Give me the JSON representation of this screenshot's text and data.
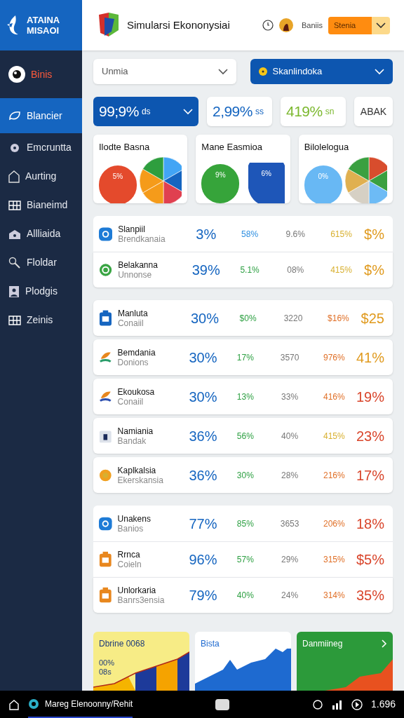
{
  "logo": {
    "lines": [
      "ATAINA",
      "MISAOI"
    ]
  },
  "header": {
    "title": "Simularsi Ekononysiai",
    "user": "Baniis",
    "select": "Stenia"
  },
  "sidebar": {
    "account": "Binis",
    "items": [
      {
        "label": "Blancier",
        "selected": true
      },
      {
        "label": "Emcruntta",
        "selected": false
      },
      {
        "label": "Aurting",
        "selected": false
      },
      {
        "label": "Bianeimd",
        "selected": false
      },
      {
        "label": "Allliaida",
        "selected": false
      },
      {
        "label": "Floldar",
        "selected": false
      },
      {
        "label": "Plodgis",
        "selected": false
      },
      {
        "label": "Zeinis",
        "selected": false
      }
    ]
  },
  "filters": [
    {
      "value": "Unmia",
      "selected": false
    },
    {
      "value": "Skanlindoka",
      "selected": true
    }
  ],
  "stats": [
    {
      "value": "99;9%",
      "unit": "ds",
      "selected": true,
      "color": "#ffffff"
    },
    {
      "value": "2,99%",
      "unit": "ss",
      "selected": false,
      "color": "#1565c0"
    },
    {
      "value": "419%",
      "unit": "sn",
      "selected": false,
      "color": "#7cb82f"
    }
  ],
  "stat_button": "ABAK",
  "pie_cards": [
    {
      "title": "Ilodte Basna",
      "labels": [
        "5%"
      ]
    },
    {
      "title": "Mane Easmioa",
      "labels": [
        "9%",
        "6%"
      ]
    },
    {
      "title": "Bilolelogua",
      "labels": [
        "0%"
      ]
    }
  ],
  "groups": [
    [
      {
        "name": "Slanpiil",
        "sub": "Brendkanaia",
        "values": [
          "3%",
          "58%",
          "9.6%",
          "615%",
          "$%"
        ],
        "color": "#e09a1e"
      },
      {
        "name": "Belakanna",
        "sub": "Unnonse",
        "values": [
          "39%",
          "5.1%",
          "08%",
          "415%",
          "$%"
        ],
        "color": "#e09a1e"
      }
    ],
    [
      {
        "name": "Manluta",
        "sub": "Conaiil",
        "values": [
          "30%",
          "$0%",
          "3220",
          "$16%",
          "$25"
        ],
        "color": "#e09a1e"
      },
      {
        "name": "Bemdania",
        "sub": "Donions",
        "values": [
          "30%",
          "17%",
          "3570",
          "976%",
          "41%"
        ],
        "color": "#e09a1e"
      },
      {
        "name": "Ekoukosa",
        "sub": "Conaiil",
        "values": [
          "30%",
          "13%",
          "33%",
          "416%",
          "19%"
        ],
        "color": "#d9452b"
      },
      {
        "name": "Namiania",
        "sub": "Bandak",
        "values": [
          "36%",
          "56%",
          "40%",
          "415%",
          "23%"
        ],
        "color": "#d9452b"
      },
      {
        "name": "Kaplkalsia",
        "sub": "Ekerskansia",
        "values": [
          "36%",
          "30%",
          "28%",
          "216%",
          "17%"
        ],
        "color": "#d9452b"
      }
    ],
    [
      {
        "name": "Unakens",
        "sub": "Banios",
        "values": [
          "77%",
          "85%",
          "3653",
          "206%",
          "18%"
        ],
        "color": "#d9452b"
      },
      {
        "name": "Rrnca",
        "sub": "Coieln",
        "values": [
          "96%",
          "57%",
          "29%",
          "315%",
          "$5%"
        ],
        "color": "#d9452b"
      },
      {
        "name": "Unlorkaria",
        "sub": "Banrs3ensia",
        "values": [
          "79%",
          "40%",
          "24%",
          "314%",
          "35%"
        ],
        "color": "#d9452b"
      }
    ]
  ],
  "bottom_cards": [
    {
      "title": "Dbrine 0068",
      "labels": [
        "00%",
        "08s"
      ]
    },
    {
      "title": "Bista"
    },
    {
      "title": "Danmiineg"
    }
  ],
  "taskbar": {
    "app": "Mareg Elenoonny/Rehit",
    "time": "1.696"
  }
}
